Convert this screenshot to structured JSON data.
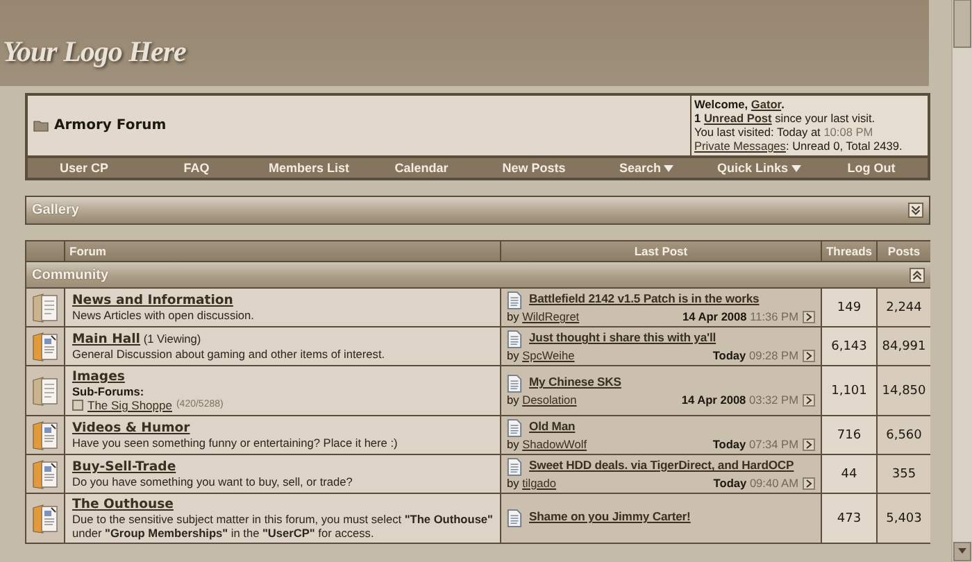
{
  "logo": {
    "text": "Your Logo Here"
  },
  "breadcrumb": {
    "title": "Armory Forum"
  },
  "welcome": {
    "greeting": "Welcome,",
    "user": "Gator",
    "user_suffix": ".",
    "unread_count": "1",
    "unread_link": "Unread Post",
    "unread_suffix": "since your last visit.",
    "last_visited": "You last visited: Today at",
    "last_visited_time": "10:08 PM",
    "pm_link": "Private Messages",
    "pm_suffix": ": Unread 0, Total 2439."
  },
  "navbar": [
    {
      "label": "User CP",
      "dropdown": false
    },
    {
      "label": "FAQ",
      "dropdown": false
    },
    {
      "label": "Members List",
      "dropdown": false
    },
    {
      "label": "Calendar",
      "dropdown": false
    },
    {
      "label": "New Posts",
      "dropdown": false
    },
    {
      "label": "Search",
      "dropdown": true
    },
    {
      "label": "Quick Links",
      "dropdown": true
    },
    {
      "label": "Log Out",
      "dropdown": false
    }
  ],
  "gallery": {
    "title": "Gallery",
    "expanded": false
  },
  "table": {
    "columns": [
      "Forum",
      "Last Post",
      "Threads",
      "Posts"
    ],
    "category": {
      "title": "Community",
      "expanded": true
    },
    "forums": [
      {
        "title": "News and Information",
        "description": "News Articles with open discussion.",
        "unread": false,
        "last_post": {
          "title": "Battlefield 2142 v1.5 Patch is in the works",
          "by": "by",
          "author": "WildRegret",
          "date": "14 Apr 2008",
          "time": "11:36 PM"
        },
        "threads": "149",
        "posts": "2,244"
      },
      {
        "title": "Main Hall",
        "viewing": "(1 Viewing)",
        "description": "General Discussion about gaming and other items of interest.",
        "unread": true,
        "last_post": {
          "title": "Just thought i share this with ya'll",
          "by": "by",
          "author": "SpcWeihe",
          "date": "Today",
          "time": "09:28 PM"
        },
        "threads": "6,143",
        "posts": "84,991"
      },
      {
        "title": "Images",
        "subforums_label": "Sub-Forums:",
        "subforums": [
          {
            "title": "The Sig Shoppe",
            "counts": "(420/5288)"
          }
        ],
        "unread": false,
        "last_post": {
          "title": "My Chinese SKS",
          "by": "by",
          "author": "Desolation",
          "date": "14 Apr 2008",
          "time": "03:32 PM"
        },
        "threads": "1,101",
        "posts": "14,850"
      },
      {
        "title": "Videos & Humor",
        "description": "Have you seen something funny or entertaining? Place it here :)",
        "unread": true,
        "last_post": {
          "title": "Old Man",
          "by": "by",
          "author": "ShadowWolf",
          "date": "Today",
          "time": "07:34 PM"
        },
        "threads": "716",
        "posts": "6,560"
      },
      {
        "title": "Buy-Sell-Trade",
        "description": "Do you have something you want to buy, sell, or trade?",
        "unread": true,
        "last_post": {
          "title": "Sweet HDD deals. via TigerDirect, and HardOCP",
          "by": "by",
          "author": "tilgado",
          "date": "Today",
          "time": "09:40 AM"
        },
        "threads": "44",
        "posts": "355"
      },
      {
        "title": "The Outhouse",
        "description": "Due to the sensitive subject matter in this forum, you must select **\"The Outhouse\"** under **\"Group Memberships\"** in the **\"UserCP\"** for access.",
        "unread": true,
        "last_post": {
          "title": "Shame on you Jimmy Carter!"
        },
        "threads": "473",
        "posts": "5,403"
      }
    ]
  }
}
